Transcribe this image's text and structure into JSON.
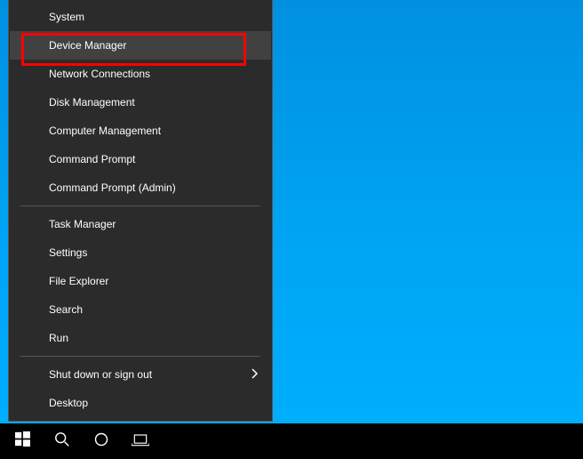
{
  "menu": {
    "group1": [
      "System",
      "Device Manager",
      "Network Connections",
      "Disk Management",
      "Computer Management",
      "Command Prompt",
      "Command Prompt (Admin)"
    ],
    "group2": [
      "Task Manager",
      "Settings",
      "File Explorer",
      "Search",
      "Run"
    ],
    "group3_shutdown": "Shut down or sign out",
    "group3_desktop": "Desktop"
  },
  "highlighted_item": "Device Manager"
}
